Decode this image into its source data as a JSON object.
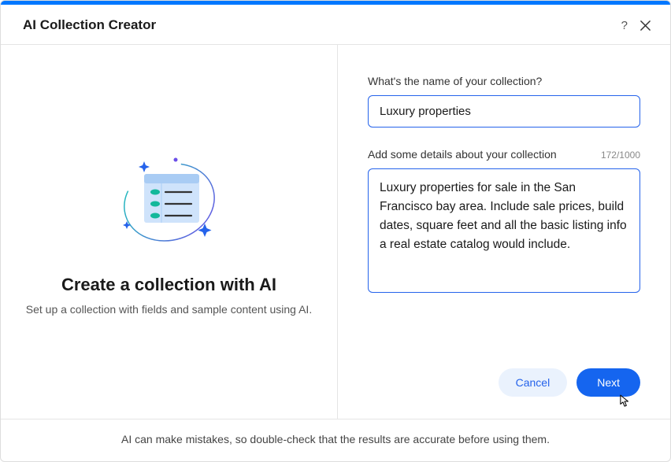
{
  "header": {
    "title": "AI Collection Creator"
  },
  "left": {
    "title": "Create a collection with AI",
    "subtitle": "Set up a collection with fields and sample content using AI."
  },
  "form": {
    "name_label": "What's the name of your collection?",
    "name_value": "Luxury properties",
    "details_label": "Add some details about your collection",
    "details_value": "Luxury properties for sale in the San Francisco bay area. Include sale prices, build dates, square feet and all the basic listing info a real estate catalog would include.",
    "char_counter": "172/1000"
  },
  "actions": {
    "cancel": "Cancel",
    "next": "Next"
  },
  "footer": {
    "disclaimer": "AI can make mistakes, so double-check that the results are accurate before using them."
  }
}
